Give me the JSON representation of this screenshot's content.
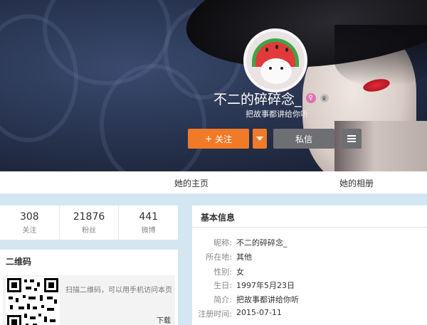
{
  "profile": {
    "username": "不二的碎碎念_",
    "bio": "把故事都讲给你听",
    "gender_icon": "female-icon",
    "badge_icon": "crown-icon"
  },
  "actions": {
    "follow_label": "关注",
    "message_label": "私信"
  },
  "tabs": [
    {
      "label": "她的主页"
    },
    {
      "label": "她的相册"
    }
  ],
  "stats": [
    {
      "value": "308",
      "label": "关注"
    },
    {
      "value": "21876",
      "label": "粉丝"
    },
    {
      "value": "441",
      "label": "微博"
    }
  ],
  "qr": {
    "title": "二维码",
    "desc": "扫描二维码，可以用手机访问本页",
    "download": "下载"
  },
  "info": {
    "title": "基本信息",
    "rows": [
      {
        "label": "昵称:",
        "value": "不二的碎碎念_"
      },
      {
        "label": "所在地:",
        "value": "其他"
      },
      {
        "label": "性别:",
        "value": "女"
      },
      {
        "label": "生日:",
        "value": "1997年5月23日"
      },
      {
        "label": "简介:",
        "value": "把故事都讲给你听"
      },
      {
        "label": "注册时间:",
        "value": "2015-07-11"
      }
    ]
  },
  "colors": {
    "accent": "#f07a28",
    "secondary_button": "#6e6f73",
    "page_bg": "#d4e6f1"
  }
}
